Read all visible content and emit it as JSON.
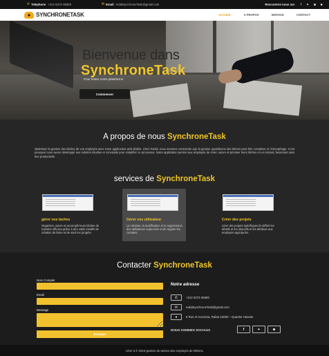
{
  "topbar": {
    "phone_icon": "phone-icon",
    "phone_label": "Telephone",
    "phone_value": "+212 5372-38383",
    "email_icon": "envelope-icon",
    "email_label": "Email",
    "email_value": "redalSynchroneTask@gmail.com",
    "follow_label": "Rencontrez-nous sur",
    "social": [
      "f",
      "t",
      "ig",
      "in"
    ]
  },
  "nav": {
    "brand": "SYNCHRONETASK",
    "links": [
      "ACCUEIL",
      "A PROPOS",
      "SERVICE",
      "CONTACT"
    ],
    "active": "ACCUEIL"
  },
  "hero": {
    "title": "Bienvenue dans",
    "brand": "SynchroneTask",
    "tagline": "Pour tester notre plateforme",
    "cta": "Commencer"
  },
  "about": {
    "title_prefix": "A propos de nous",
    "title_brand": "SynchroneTask",
    "text": "Optimisez la gestion des tâches de vos employés avec notre application web dédiée. Chez Redal, nous sommes conscients que la gestion quotidienne des tâches peut être complexe et chronophage. C'est pourquoi nous avons développé une solution intuitive et conviviale pour simplifier ce processus. Notre application permet aux employés de créer, suivre et prioriser leurs tâches en un instant, favorisant ainsi leur productivité."
  },
  "services": {
    "title_prefix": "services de",
    "title_brand": "SynchroneTask",
    "items": [
      {
        "title": "gérer vos taches",
        "desc": "Organiser, suivre et accomplir leurs tâches de manière efficace grâce à des outils intuitifs de création de listes et de suivi les progrès."
      },
      {
        "title": "Gérer vos utilisateur",
        "desc": "La création, la modification et la suppression des utilisateurs superviser et de réguler les comptes."
      },
      {
        "title": "Créer des projets",
        "desc": "créer des projets spécifiques,ils définir les détails et les objectifs et les attribuer aux employés appropriés."
      }
    ]
  },
  "contact": {
    "title_prefix": "Contacter",
    "title_brand": "SynchroneTask",
    "name_label": "Nom Complet",
    "email_label": "Email",
    "message_label": "Message",
    "send_label": "Envoyer",
    "address_title": "Notre adresse",
    "phone": "+212 5372-38383",
    "email": "redalSynchroneTask@gmail.com",
    "address": "6 Rue Al Hoceima, Rabat 10000 – Quartier Hassan",
    "follow_label": "NOUS SOMMES SOCIAUX",
    "social": [
      "f",
      "t",
      "ig"
    ]
  },
  "footer": {
    "text": "créer à © 2023 gestion de taches des employés de REDAL"
  }
}
